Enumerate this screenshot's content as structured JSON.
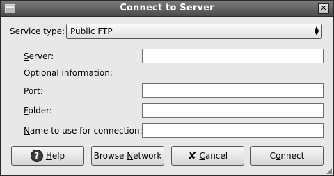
{
  "window": {
    "title": "Connect to Server"
  },
  "form": {
    "service_type": {
      "label_pre": "Ser",
      "label_mnemonic": "v",
      "label_post": "ice type:",
      "value": "Public FTP"
    },
    "server": {
      "label_mnemonic": "S",
      "label_post": "erver:",
      "value": ""
    },
    "optional_heading": "Optional information:",
    "port": {
      "label_mnemonic": "P",
      "label_post": "ort:",
      "value": ""
    },
    "folder": {
      "label_mnemonic": "F",
      "label_post": "older:",
      "value": ""
    },
    "connection_name": {
      "label_mnemonic": "N",
      "label_post": "ame to use for connection:",
      "value": ""
    }
  },
  "buttons": {
    "help": {
      "icon": "?",
      "mnemonic": "H",
      "post": "elp"
    },
    "browse": {
      "pre": "Browse ",
      "mnemonic": "N",
      "post": "etwork"
    },
    "cancel": {
      "icon": "✘",
      "mnemonic": "C",
      "post": "ancel"
    },
    "connect": {
      "pre": "C",
      "mnemonic": "o",
      "post": "nnect"
    }
  }
}
